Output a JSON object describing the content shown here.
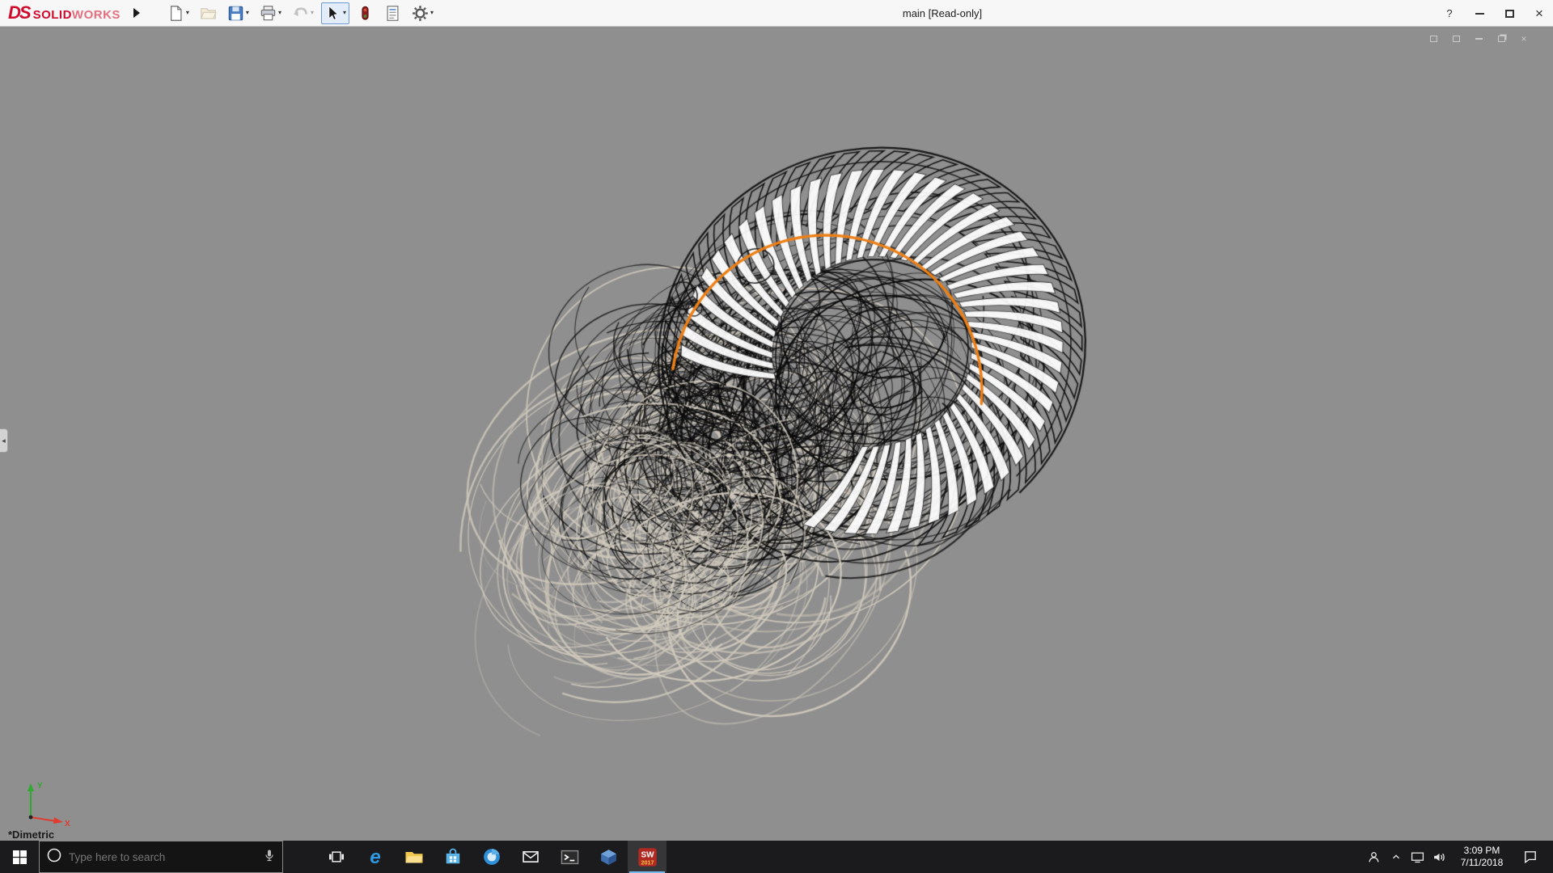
{
  "window": {
    "title": "main [Read-only]",
    "help_glyph": "?",
    "close_glyph": "×",
    "brand": {
      "ds": "DS",
      "solid": "SOLID",
      "works": "WORKS"
    }
  },
  "toolbar": {
    "items": [
      {
        "name": "new-document",
        "dropdown": true,
        "disabled": false,
        "active": false
      },
      {
        "name": "open",
        "dropdown": false,
        "disabled": true,
        "active": false
      },
      {
        "name": "save",
        "dropdown": true,
        "disabled": false,
        "active": false
      },
      {
        "name": "print",
        "dropdown": true,
        "disabled": false,
        "active": false
      },
      {
        "name": "undo",
        "dropdown": true,
        "disabled": true,
        "active": false
      },
      {
        "name": "select",
        "dropdown": true,
        "disabled": false,
        "active": true
      },
      {
        "name": "rebuild",
        "dropdown": false,
        "disabled": false,
        "active": false
      },
      {
        "name": "file-properties",
        "dropdown": false,
        "disabled": false,
        "active": false
      },
      {
        "name": "options",
        "dropdown": true,
        "disabled": false,
        "active": false
      }
    ]
  },
  "viewport": {
    "view_label": "*Dimetric",
    "background": "#8f8f8f",
    "colors": {
      "wire_dark": "#111111",
      "wire_light": "#ffffff",
      "wire_tan": "#cec7ba",
      "highlight": "#ee7f14"
    },
    "child_controls": [
      "dock",
      "float",
      "minimize",
      "restore",
      "close"
    ],
    "triad": {
      "x_label": "X",
      "y_label": "Y",
      "x_color": "#e03c31",
      "y_color": "#2eaa2e"
    }
  },
  "taskbar": {
    "search_placeholder": "Type here to search",
    "apps": [
      "task-view",
      "edge",
      "file-explorer",
      "store",
      "browser",
      "mail",
      "terminal",
      "cad-cube",
      "solidworks"
    ],
    "active_app": "solidworks",
    "solidworks_badge": {
      "top": "SW",
      "bottom": "2017"
    },
    "tray": [
      "person",
      "chevron-up",
      "display",
      "volume"
    ],
    "clock": {
      "time": "3:09 PM",
      "date": "7/11/2018"
    }
  }
}
